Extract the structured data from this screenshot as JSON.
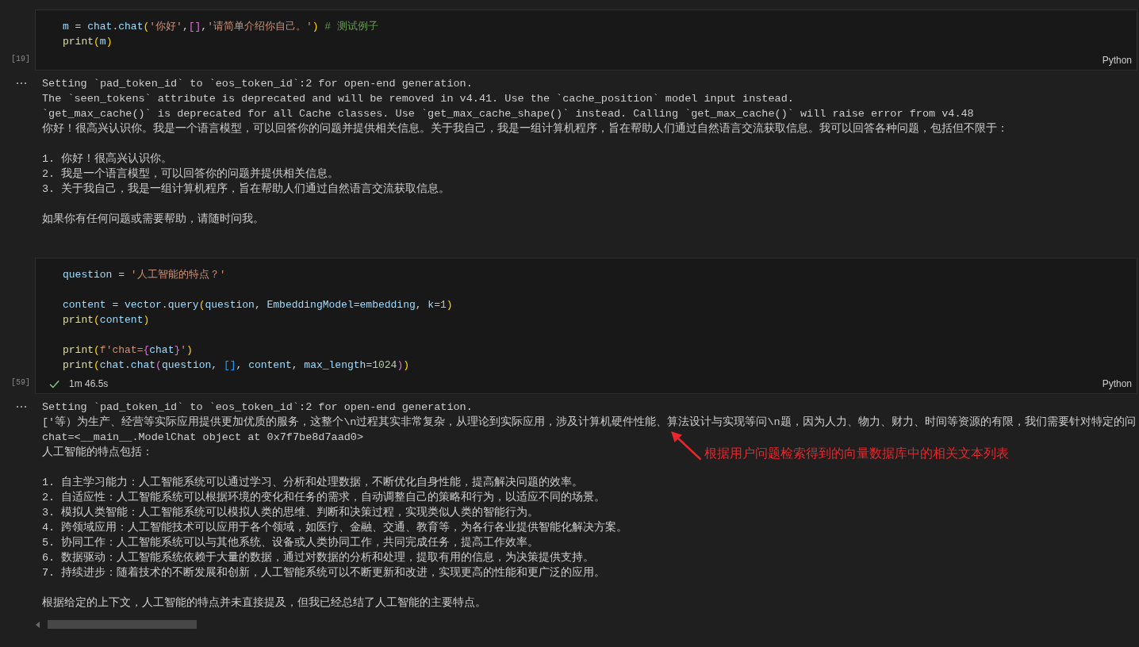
{
  "cells": [
    {
      "execution_count": "[19]",
      "language": "Python",
      "code": [
        [
          [
            {
              "text": "m",
              "kind": "var"
            },
            {
              "text": " = ",
              "kind": "op"
            },
            {
              "text": "chat",
              "kind": "var"
            },
            {
              "text": ".",
              "kind": "op"
            },
            {
              "text": "chat",
              "kind": "var"
            },
            {
              "text": "(",
              "kind": "b1"
            },
            {
              "text": "'你好'",
              "kind": "str"
            },
            {
              "text": ",",
              "kind": "op"
            },
            {
              "text": "[]",
              "kind": "b2"
            },
            {
              "text": ",",
              "kind": "op"
            },
            {
              "text": "'请简单介绍你自己。'",
              "kind": "str"
            },
            {
              "text": ")",
              "kind": "b1"
            },
            {
              "text": " # 测试例子",
              "kind": "comment"
            }
          ],
          [
            {
              "text": "print",
              "kind": "func"
            },
            {
              "text": "(",
              "kind": "b1"
            },
            {
              "text": "m",
              "kind": "var"
            },
            {
              "text": ")",
              "kind": "b1"
            }
          ]
        ]
      ],
      "output": {
        "blocks": [
          [
            "Setting `pad_token_id` to `eos_token_id`:2 for open-end generation.",
            "The `seen_tokens` attribute is deprecated and will be removed in v4.41. Use the `cache_position` model input instead.",
            "`get_max_cache()` is deprecated for all Cache classes. Use `get_max_cache_shape()` instead. Calling `get_max_cache()` will raise error from v4.48",
            "你好！很高兴认识你。我是一个语言模型，可以回答你的问题并提供相关信息。关于我自己，我是一组计算机程序，旨在帮助人们通过自然语言交流获取信息。我可以回答各种问题，包括但不限于："
          ],
          [
            "1. 你好！很高兴认识你。",
            "2. 我是一个语言模型，可以回答你的问题并提供相关信息。",
            "3. 关于我自己，我是一组计算机程序，旨在帮助人们通过自然语言交流获取信息。"
          ],
          [
            "如果你有任何问题或需要帮助，请随时问我。"
          ]
        ]
      }
    },
    {
      "execution_count": "[59]",
      "language": "Python",
      "status": {
        "succeeded": true,
        "duration": "1m 46.5s"
      },
      "code": [
        [
          [
            {
              "text": "question",
              "kind": "var"
            },
            {
              "text": " = ",
              "kind": "op"
            },
            {
              "text": "'人工智能的特点？'",
              "kind": "str"
            }
          ]
        ],
        [
          [
            {
              "text": "content",
              "kind": "var"
            },
            {
              "text": " = ",
              "kind": "op"
            },
            {
              "text": "vector",
              "kind": "var"
            },
            {
              "text": ".",
              "kind": "op"
            },
            {
              "text": "query",
              "kind": "var"
            },
            {
              "text": "(",
              "kind": "b1"
            },
            {
              "text": "question",
              "kind": "var"
            },
            {
              "text": ", ",
              "kind": "op"
            },
            {
              "text": "EmbeddingModel",
              "kind": "var"
            },
            {
              "text": "=",
              "kind": "op"
            },
            {
              "text": "embedding",
              "kind": "var"
            },
            {
              "text": ", ",
              "kind": "op"
            },
            {
              "text": "k",
              "kind": "var"
            },
            {
              "text": "=",
              "kind": "op"
            },
            {
              "text": "1",
              "kind": "num"
            },
            {
              "text": ")",
              "kind": "b1"
            }
          ],
          [
            {
              "text": "print",
              "kind": "func"
            },
            {
              "text": "(",
              "kind": "b1"
            },
            {
              "text": "content",
              "kind": "var"
            },
            {
              "text": ")",
              "kind": "b1"
            }
          ]
        ],
        [
          [
            {
              "text": "print",
              "kind": "func"
            },
            {
              "text": "(",
              "kind": "b1"
            },
            {
              "text": "f'chat=",
              "kind": "str"
            },
            {
              "text": "{",
              "kind": "b2"
            },
            {
              "text": "chat",
              "kind": "var"
            },
            {
              "text": "}",
              "kind": "b2"
            },
            {
              "text": "'",
              "kind": "str"
            },
            {
              "text": ")",
              "kind": "b1"
            }
          ],
          [
            {
              "text": "print",
              "kind": "func"
            },
            {
              "text": "(",
              "kind": "b1"
            },
            {
              "text": "chat",
              "kind": "var"
            },
            {
              "text": ".",
              "kind": "op"
            },
            {
              "text": "chat",
              "kind": "var"
            },
            {
              "text": "(",
              "kind": "b2"
            },
            {
              "text": "question",
              "kind": "var"
            },
            {
              "text": ", ",
              "kind": "op"
            },
            {
              "text": "[]",
              "kind": "b3"
            },
            {
              "text": ", ",
              "kind": "op"
            },
            {
              "text": "content",
              "kind": "var"
            },
            {
              "text": ", ",
              "kind": "op"
            },
            {
              "text": "max_length",
              "kind": "var"
            },
            {
              "text": "=",
              "kind": "op"
            },
            {
              "text": "1024",
              "kind": "num"
            },
            {
              "text": ")",
              "kind": "b2"
            },
            {
              "text": ")",
              "kind": "b1"
            }
          ]
        ]
      ],
      "output": {
        "blocks": [
          [
            "Setting `pad_token_id` to `eos_token_id`:2 for open-end generation.",
            "['等）为生产、经营等实际应用提供更加优质的服务，这整个\\n过程其实非常复杂，从理论到实际应用，涉及计算机硬件性能、算法设计与实现等问\\n题，因为人力、物力、财力、时间等资源的有限，我们需要针对特定的问",
            "chat=<__main__.ModelChat object at 0x7f7be8d7aad0>",
            "人工智能的特点包括："
          ],
          [
            "1. 自主学习能力：人工智能系统可以通过学习、分析和处理数据，不断优化自身性能，提高解决问题的效率。",
            "2. 自适应性：人工智能系统可以根据环境的变化和任务的需求，自动调整自己的策略和行为，以适应不同的场景。",
            "3. 模拟人类智能：人工智能系统可以模拟人类的思维、判断和决策过程，实现类似人类的智能行为。",
            "4. 跨领域应用：人工智能技术可以应用于各个领域，如医疗、金融、交通、教育等，为各行各业提供智能化解决方案。",
            "5. 协同工作：人工智能系统可以与其他系统、设备或人类协同工作，共同完成任务，提高工作效率。",
            "6. 数据驱动：人工智能系统依赖于大量的数据，通过对数据的分析和处理，提取有用的信息，为决策提供支持。",
            "7. 持续进步：随着技术的不断发展和创新，人工智能系统可以不断更新和改进，实现更高的性能和更广泛的应用。"
          ],
          [
            "根据给定的上下文，人工智能的特点并未直接提及，但我已经总结了人工智能的主要特点。"
          ]
        ],
        "horizontal_scrollbar": true,
        "annotation": {
          "text": "根据用户问题检索得到的向量数据库中的相关文本列表"
        }
      }
    }
  ]
}
